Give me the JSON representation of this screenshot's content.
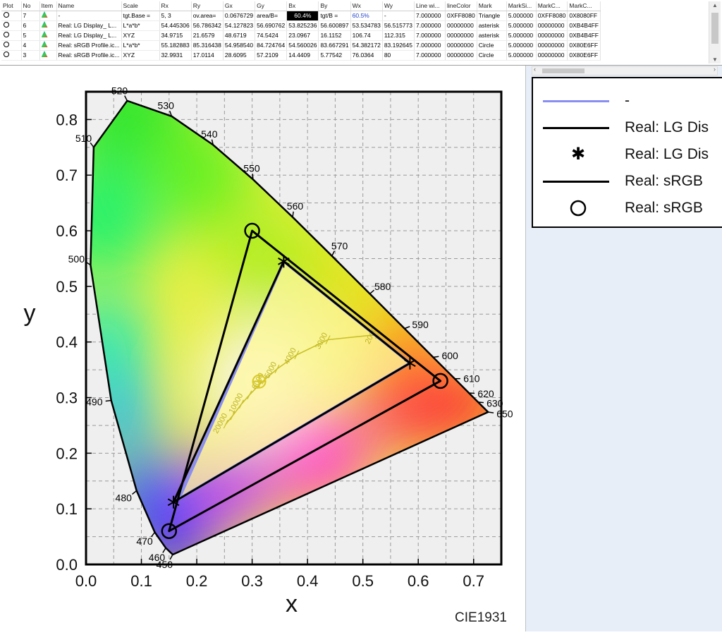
{
  "table": {
    "columns": [
      "Plot",
      "No",
      "Item",
      "Name",
      "Scale",
      "Rx",
      "Ry",
      "Gx",
      "Gy",
      "Bx",
      "By",
      "Wx",
      "Wy",
      "Line wi...",
      "lineColor",
      "Mark",
      "MarkSi...",
      "MarkC...",
      "MarkC..."
    ],
    "rows": [
      {
        "no": "7",
        "name": "-",
        "scale": "tgt.Base =",
        "rx": "5, 3",
        "ry": "ov.area=",
        "gx": "0.0676729",
        "gy": "area/B=",
        "bx": "60.4%",
        "by": "tgt/B =",
        "wx": "60.5%",
        "wy": "-",
        "lw": "7.000000",
        "lc": "0XFF8080",
        "mark": "Triangle",
        "ms": "5.000000",
        "mc1": "0XFF8080",
        "mc2": "0X8080FF"
      },
      {
        "no": "6",
        "name": "Real: LG Display_ L...",
        "scale": "L*a*b*",
        "rx": "54.445306",
        "ry": "56.786342",
        "gx": "54.127823",
        "gy": "56.690762",
        "bx": "53.825236",
        "by": "56.600897",
        "wx": "53.534783",
        "wy": "56.515773",
        "lw": "7.000000",
        "lc": "00000000",
        "mark": "asterisk",
        "ms": "5.000000",
        "mc1": "00000000",
        "mc2": "0XB4B4FF"
      },
      {
        "no": "5",
        "name": "Real: LG Display_ L...",
        "scale": "XYZ",
        "rx": "34.9715",
        "ry": "21.6579",
        "gx": "48.6719",
        "gy": "74.5424",
        "bx": "23.0967",
        "by": "16.1152",
        "wx": "106.74",
        "wy": "112.315",
        "lw": "7.000000",
        "lc": "00000000",
        "mark": "asterisk",
        "ms": "5.000000",
        "mc1": "00000000",
        "mc2": "0XB4B4FF"
      },
      {
        "no": "4",
        "name": "Real: sRGB Profile.ic...",
        "scale": "L*a*b*",
        "rx": "55.182883",
        "ry": "85.316438",
        "gx": "54.958540",
        "gy": "84.724764",
        "bx": "54.560026",
        "by": "83.667291",
        "wx": "54.382172",
        "wy": "83.192645",
        "lw": "7.000000",
        "lc": "00000000",
        "mark": "Circle",
        "ms": "5.000000",
        "mc1": "00000000",
        "mc2": "0X80E6FF"
      },
      {
        "no": "3",
        "name": "Real: sRGB Profile.ic...",
        "scale": "XYZ",
        "rx": "32.9931",
        "ry": "17.0114",
        "gx": "28.6095",
        "gy": "57.2109",
        "bx": "14.4409",
        "by": "5.77542",
        "wx": "76.0364",
        "wy": "80",
        "lw": "7.000000",
        "lc": "00000000",
        "mark": "Circle",
        "ms": "5.000000",
        "mc1": "00000000",
        "mc2": "0X80E6FF"
      }
    ]
  },
  "legend": {
    "items": [
      {
        "label": "-",
        "kind": "line",
        "color": "#8a8ef0"
      },
      {
        "label": "Real: LG Dis",
        "kind": "line",
        "color": "#000000"
      },
      {
        "label": "Real: LG Dis",
        "kind": "asterisk",
        "color": "#000000"
      },
      {
        "label": "Real: sRGB",
        "kind": "line",
        "color": "#000000"
      },
      {
        "label": "Real: sRGB",
        "kind": "circle",
        "color": "#000000"
      }
    ]
  },
  "chart_data": {
    "type": "scatter",
    "title": "",
    "xlabel": "x",
    "ylabel": "y",
    "xlim": [
      0,
      0.75
    ],
    "ylim": [
      0,
      0.85
    ],
    "xticks": [
      0.0,
      0.1,
      0.2,
      0.3,
      0.4,
      0.5,
      0.6,
      0.7
    ],
    "yticks": [
      0.0,
      0.1,
      0.2,
      0.3,
      0.4,
      0.5,
      0.6,
      0.7,
      0.8
    ],
    "grid": true,
    "watermark": "CIE1931",
    "spectral_locus": [
      {
        "nm": 450,
        "x": 0.1566,
        "y": 0.0177
      },
      {
        "nm": 460,
        "x": 0.144,
        "y": 0.0297
      },
      {
        "nm": 470,
        "x": 0.1241,
        "y": 0.0578
      },
      {
        "nm": 480,
        "x": 0.0913,
        "y": 0.1327
      },
      {
        "nm": 490,
        "x": 0.0454,
        "y": 0.295
      },
      {
        "nm": 500,
        "x": 0.0082,
        "y": 0.5384
      },
      {
        "nm": 510,
        "x": 0.0139,
        "y": 0.7502
      },
      {
        "nm": 520,
        "x": 0.0743,
        "y": 0.8338
      },
      {
        "nm": 530,
        "x": 0.1547,
        "y": 0.8059
      },
      {
        "nm": 540,
        "x": 0.2296,
        "y": 0.7543
      },
      {
        "nm": 550,
        "x": 0.3016,
        "y": 0.6923
      },
      {
        "nm": 560,
        "x": 0.3731,
        "y": 0.6245
      },
      {
        "nm": 570,
        "x": 0.4441,
        "y": 0.5547
      },
      {
        "nm": 580,
        "x": 0.5125,
        "y": 0.4866
      },
      {
        "nm": 590,
        "x": 0.5752,
        "y": 0.4242
      },
      {
        "nm": 600,
        "x": 0.627,
        "y": 0.3725
      },
      {
        "nm": 610,
        "x": 0.6658,
        "y": 0.334
      },
      {
        "nm": 620,
        "x": 0.6915,
        "y": 0.3083
      },
      {
        "nm": 630,
        "x": 0.7079,
        "y": 0.292
      },
      {
        "nm": 650,
        "x": 0.726,
        "y": 0.274
      }
    ],
    "series": [
      {
        "name": "-",
        "color": "#8a8ef0",
        "fill": "#fff8a0",
        "points": [
          {
            "x": 0.357,
            "y": 0.545
          },
          {
            "x": 0.585,
            "y": 0.362
          },
          {
            "x": 0.168,
            "y": 0.118
          }
        ]
      },
      {
        "name": "Real: LG Dis",
        "marker": "asterisk",
        "color": "#000000",
        "points": [
          {
            "x": 0.357,
            "y": 0.545
          },
          {
            "x": 0.585,
            "y": 0.362
          },
          {
            "x": 0.158,
            "y": 0.112
          }
        ]
      },
      {
        "name": "Real: sRGB",
        "marker": "circle",
        "color": "#000000",
        "points": [
          {
            "x": 0.3,
            "y": 0.6
          },
          {
            "x": 0.64,
            "y": 0.33
          },
          {
            "x": 0.15,
            "y": 0.06
          }
        ]
      }
    ],
    "white_point": {
      "x": 0.3127,
      "y": 0.329
    },
    "planckian_locus": [
      {
        "x": 0.2525,
        "y": 0.2523,
        "label": "20000"
      },
      {
        "x": 0.2647,
        "y": 0.2673,
        "label": "15000"
      },
      {
        "x": 0.2807,
        "y": 0.2883,
        "label": "10000"
      },
      {
        "x": 0.2952,
        "y": 0.3048,
        "label": "8000"
      },
      {
        "x": 0.3135,
        "y": 0.3236,
        "label": "6500"
      },
      {
        "x": 0.3221,
        "y": 0.3318,
        "label": "6000"
      },
      {
        "x": 0.3451,
        "y": 0.3516,
        "label": "5000"
      },
      {
        "x": 0.3805,
        "y": 0.3768,
        "label": "4000"
      },
      {
        "x": 0.4369,
        "y": 0.4041,
        "label": "3000"
      },
      {
        "x": 0.5267,
        "y": 0.4133,
        "label": "2000"
      }
    ],
    "cct_labels": [
      "2000",
      "3000",
      "4000",
      "5000",
      "6000",
      "10000",
      "20000"
    ]
  }
}
